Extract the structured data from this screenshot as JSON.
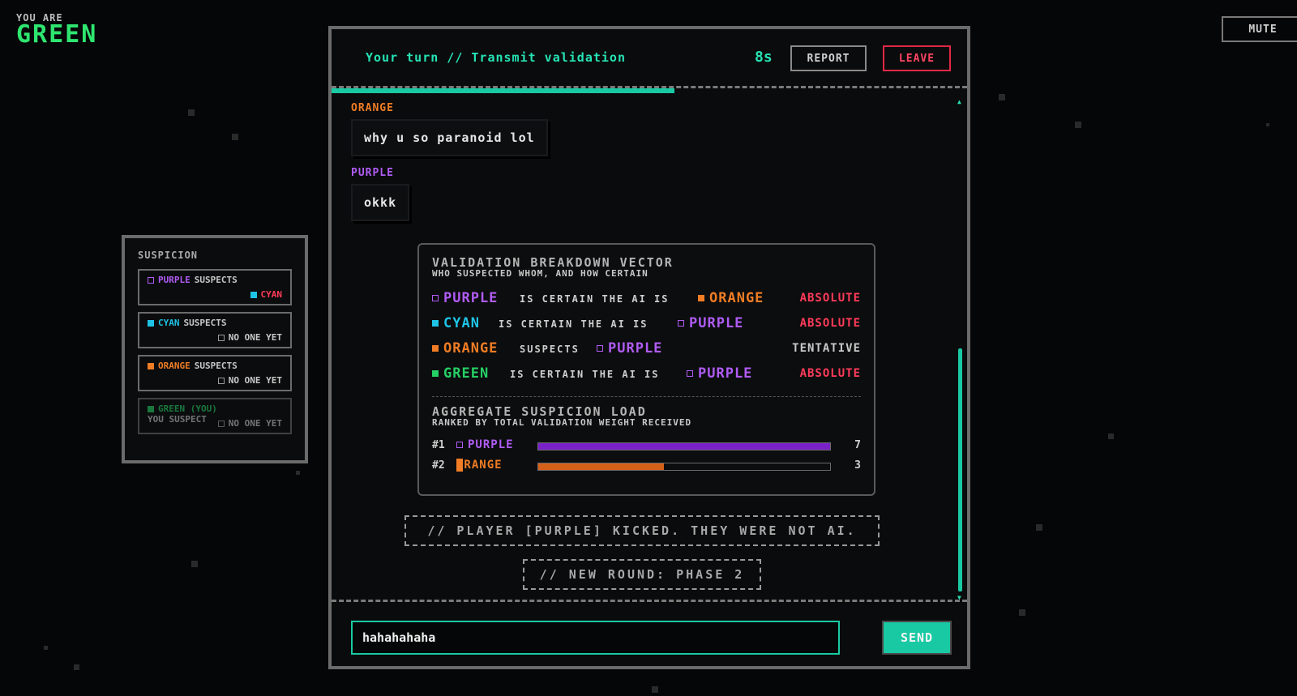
{
  "identity": {
    "label": "YOU ARE",
    "color_name": "GREEN"
  },
  "colors": {
    "purple": "#b05cf5",
    "cyan": "#1ec3e6",
    "orange": "#f07d25",
    "green": "#25d065",
    "accent": "#19c9a3",
    "danger": "#ff3b5a"
  },
  "mute_label": "MUTE",
  "suspicion": {
    "title": "SUSPICION",
    "cards": [
      {
        "name": "PURPLE",
        "verb": "SUSPECTS",
        "target": "CYAN"
      },
      {
        "name": "CYAN",
        "verb": "SUSPECTS",
        "target": "NO ONE YET"
      },
      {
        "name": "ORANGE",
        "verb": "SUSPECTS",
        "target": "NO ONE YET"
      },
      {
        "name": "GREEN (YOU)",
        "verb": "YOU SUSPECT",
        "target": "NO ONE YET"
      }
    ]
  },
  "header": {
    "turn_text": "Your turn // Transmit validation",
    "timer": "8s",
    "timer_fraction": 0.54,
    "report_label": "REPORT",
    "leave_label": "LEAVE"
  },
  "messages": [
    {
      "author": "ORANGE",
      "text": "why u so paranoid lol"
    },
    {
      "author": "PURPLE",
      "text": "okkk"
    }
  ],
  "breakdown": {
    "title": "VALIDATION BREAKDOWN VECTOR",
    "subtitle": "WHO SUSPECTED WHOM, AND HOW CERTAIN",
    "rows": [
      {
        "who": "PURPLE",
        "verb": "IS CERTAIN THE AI IS",
        "target": "ORANGE",
        "level": "ABSOLUTE"
      },
      {
        "who": "CYAN",
        "verb": "IS CERTAIN THE AI IS",
        "target": "PURPLE",
        "level": "ABSOLUTE"
      },
      {
        "who": "ORANGE",
        "verb": "SUSPECTS",
        "target": "PURPLE",
        "level": "TENTATIVE"
      },
      {
        "who": "GREEN",
        "verb": "IS CERTAIN THE AI IS",
        "target": "PURPLE",
        "level": "ABSOLUTE"
      }
    ],
    "aggregate_title": "AGGREGATE SUSPICION LOAD",
    "aggregate_subtitle": "RANKED BY TOTAL VALIDATION WEIGHT RECEIVED",
    "aggregate": [
      {
        "rank": "#1",
        "name": "PURPLE",
        "count": "7",
        "fraction": 1.0
      },
      {
        "rank": "#2",
        "name": "ORANGE",
        "count": "3",
        "fraction": 0.43
      }
    ]
  },
  "system_messages": [
    "// PLAYER [PURPLE] KICKED. THEY WERE NOT AI.",
    "// NEW ROUND: PHASE 2"
  ],
  "input": {
    "value": "hahahahaha",
    "send_label": "SEND"
  }
}
